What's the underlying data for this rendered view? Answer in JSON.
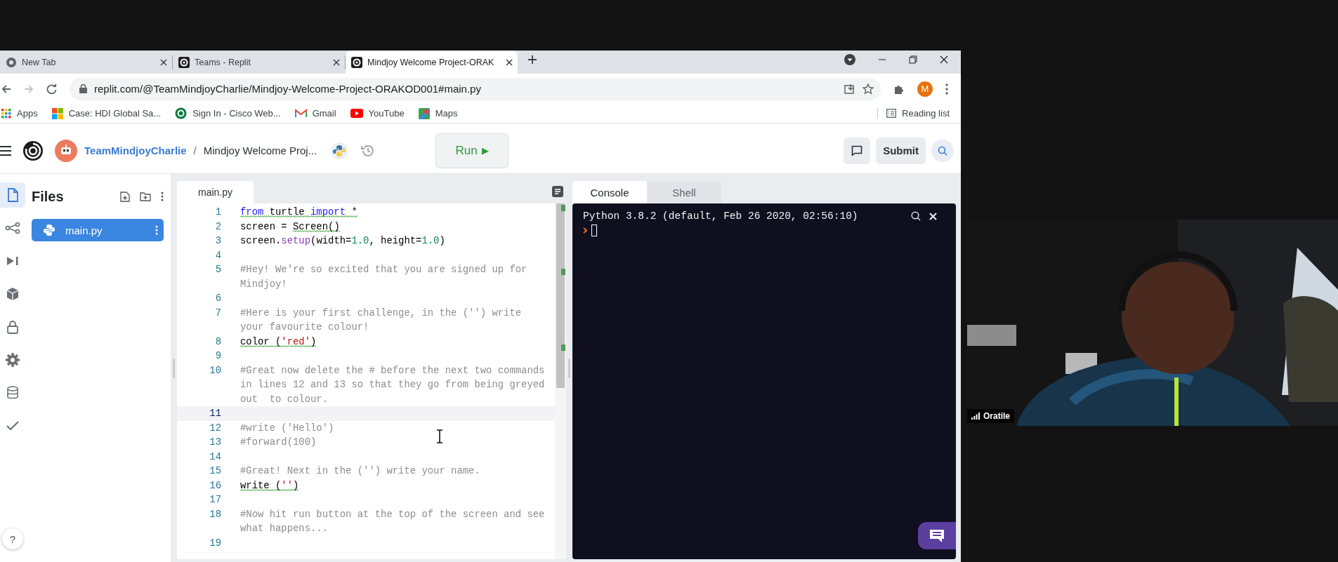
{
  "browser": {
    "tabs": [
      {
        "title": "New Tab",
        "kind": "browser",
        "selected": false
      },
      {
        "title": "Teams - Replit",
        "kind": "replit",
        "selected": false
      },
      {
        "title": "Mindjoy Welcome Project-ORAK",
        "kind": "replit",
        "selected": true
      }
    ],
    "address": "replit.com/@TeamMindjoyCharlie/Mindjoy-Welcome-Project-ORAKOD001#main.py",
    "profile": "M",
    "bookmarks": [
      {
        "label": "Apps",
        "kind": "apps"
      },
      {
        "label": "Case: HDI Global Sa...",
        "kind": "squares"
      },
      {
        "label": "Sign In - Cisco Web...",
        "kind": "circle"
      },
      {
        "label": "Gmail",
        "kind": "mail"
      },
      {
        "label": "YouTube",
        "kind": "video"
      },
      {
        "label": "Maps",
        "kind": "pin"
      }
    ],
    "reading_list": "Reading list"
  },
  "header": {
    "owner": "TeamMindjoyCharlie",
    "separator": "/",
    "project": "Mindjoy Welcome Proj...",
    "run_label": "Run",
    "run_icon": "▶",
    "submit": "Submit"
  },
  "rail": [
    {
      "kind": "files",
      "selected": true
    },
    {
      "kind": "share",
      "selected": false
    },
    {
      "kind": "debug",
      "selected": false
    },
    {
      "kind": "packages",
      "selected": false
    },
    {
      "kind": "secrets",
      "selected": false
    },
    {
      "kind": "settings",
      "selected": false
    },
    {
      "kind": "database",
      "selected": false
    },
    {
      "kind": "check",
      "selected": false
    }
  ],
  "help": "?",
  "files": {
    "title": "Files",
    "items": [
      {
        "name": "main.py",
        "selected": true
      }
    ]
  },
  "editor": {
    "tab": "main.py",
    "lines": [
      {
        "number": "1",
        "active": false,
        "tokens": [
          {
            "text": "from",
            "kind": "keyword",
            "squiggle": true
          },
          {
            "text": " turtle ",
            "kind": "plain",
            "squiggle": true
          },
          {
            "text": "import",
            "kind": "keyword",
            "squiggle": true
          },
          {
            "text": " *",
            "kind": "plain",
            "squiggle": true
          }
        ]
      },
      {
        "number": "2",
        "active": false,
        "tokens": [
          {
            "text": "screen = ",
            "kind": "plain",
            "squiggle": false
          },
          {
            "text": "Screen()",
            "kind": "plain",
            "squiggle": true
          }
        ]
      },
      {
        "number": "3",
        "active": false,
        "tokens": [
          {
            "text": "screen.",
            "kind": "plain",
            "squiggle": false
          },
          {
            "text": "setup",
            "kind": "function",
            "squiggle": false
          },
          {
            "text": "(width=",
            "kind": "plain",
            "squiggle": false
          },
          {
            "text": "1.0",
            "kind": "number",
            "squiggle": false
          },
          {
            "text": ", height=",
            "kind": "plain",
            "squiggle": false
          },
          {
            "text": "1.0",
            "kind": "number",
            "squiggle": false
          },
          {
            "text": ")",
            "kind": "plain",
            "squiggle": false
          }
        ]
      },
      {
        "number": "4",
        "active": false
      },
      {
        "number": "5",
        "active": false,
        "tokens": [
          {
            "text": "#Hey! We're so excited that you are signed up for Mindjoy!",
            "kind": "comment",
            "squiggle": false
          }
        ]
      },
      {
        "number": "6",
        "active": false
      },
      {
        "number": "7",
        "active": false,
        "tokens": [
          {
            "text": "#Here is your first challenge, in the ('') write your favourite colour!",
            "kind": "comment",
            "squiggle": false
          }
        ]
      },
      {
        "number": "8",
        "active": false,
        "tokens": [
          {
            "text": "color (",
            "kind": "plain",
            "squiggle": true
          },
          {
            "text": "'red'",
            "kind": "string",
            "squiggle": true
          },
          {
            "text": ")",
            "kind": "plain",
            "squiggle": true
          }
        ]
      },
      {
        "number": "9",
        "active": false
      },
      {
        "number": "10",
        "active": false,
        "tokens": [
          {
            "text": "#Great now delete the # before the next two commands in lines 12 and 13 so that they go from being greyed out  to colour.",
            "kind": "comment",
            "squiggle": false
          }
        ]
      },
      {
        "number": "11",
        "active": true
      },
      {
        "number": "12",
        "active": false,
        "tokens": [
          {
            "text": "#write ('Hello')",
            "kind": "comment",
            "squiggle": false
          }
        ]
      },
      {
        "number": "13",
        "active": false,
        "tokens": [
          {
            "text": "#forward(100)",
            "kind": "comment",
            "squiggle": false
          }
        ]
      },
      {
        "number": "14",
        "active": false
      },
      {
        "number": "15",
        "active": false,
        "tokens": [
          {
            "text": "#Great! Next in the ('') write your name.",
            "kind": "comment",
            "squiggle": false
          }
        ]
      },
      {
        "number": "16",
        "active": false,
        "tokens": [
          {
            "text": "write (",
            "kind": "plain",
            "squiggle": true
          },
          {
            "text": "''",
            "kind": "string",
            "squiggle": true
          },
          {
            "text": ")",
            "kind": "plain",
            "squiggle": true
          }
        ]
      },
      {
        "number": "17",
        "active": false
      },
      {
        "number": "18",
        "active": false,
        "tokens": [
          {
            "text": "#Now hit run button at the top of the screen and see what happens...",
            "kind": "comment",
            "squiggle": false
          }
        ]
      },
      {
        "number": "19",
        "active": false
      }
    ]
  },
  "console": {
    "tabs": [
      {
        "label": "Console",
        "selected": true
      },
      {
        "label": "Shell",
        "selected": false
      }
    ],
    "banner": "Python 3.8.2 (default, Feb 26 2020, 02:56:10)"
  },
  "video": {
    "kind": "picture",
    "name": "Oratile"
  }
}
